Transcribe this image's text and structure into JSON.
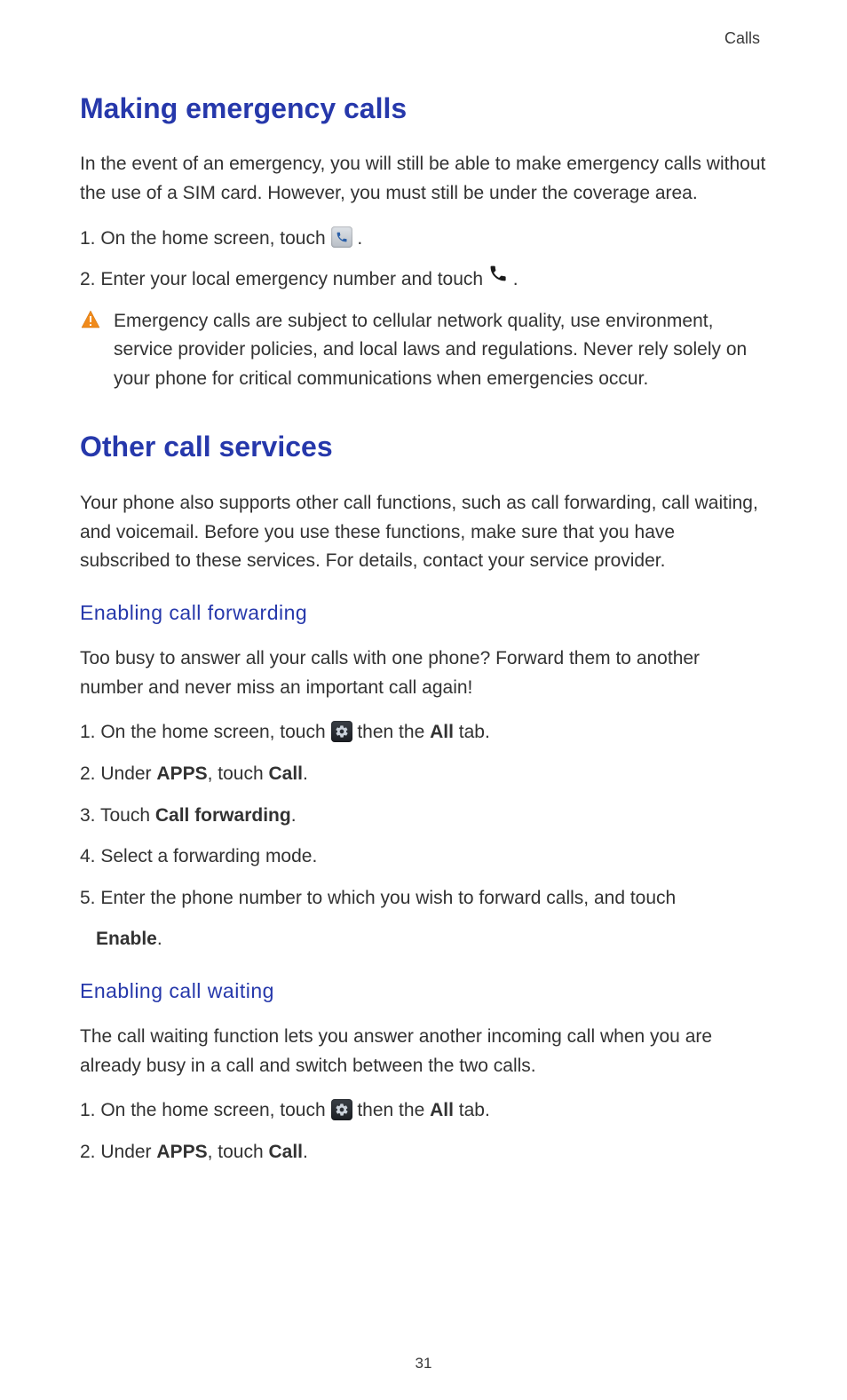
{
  "header": {
    "section_label": "Calls"
  },
  "emergency": {
    "heading": "Making emergency calls",
    "intro": "In the event of an emergency, you will still be able to make emergency calls without the use of a SIM card. However, you must still be under the coverage area.",
    "step1_pre": "1. On the home screen, touch ",
    "step1_post": " .",
    "step2_pre": "2. Enter your local emergency number and touch ",
    "step2_post": " .",
    "warning_text": "Emergency calls are subject to cellular network quality, use environment, service provider policies, and local laws and regulations. Never rely solely on your phone for critical communications when emergencies occur."
  },
  "other": {
    "heading": "Other call services",
    "intro": "Your phone also supports other call functions, such as call forwarding, call waiting, and voicemail. Before you use these functions, make sure that you have subscribed to these services. For details, contact your service provider."
  },
  "forwarding": {
    "subheading": "Enabling call forwarding",
    "intro": "Too busy to answer all your calls with one phone? Forward them to another number and never miss an important call again!",
    "s1_pre": "1. On the home screen, touch ",
    "s1_mid": " then the ",
    "s1_bold": "All",
    "s1_post": " tab.",
    "s2_pre": "2. Under ",
    "s2_b1": "APPS",
    "s2_mid": ", touch ",
    "s2_b2": "Call",
    "s2_post": ".",
    "s3_pre": "3. Touch ",
    "s3_b": "Call forwarding",
    "s3_post": ".",
    "s4": "4. Select a forwarding mode.",
    "s5_pre": "5. Enter the phone number to which you wish to forward calls, and touch ",
    "s5_b": "Enable",
    "s5_post": "."
  },
  "waiting": {
    "subheading": "Enabling call waiting",
    "intro": "The call waiting function lets you answer another incoming call when you are already busy in a call and switch between the two calls.",
    "s1_pre": "1. On the home screen, touch ",
    "s1_mid": " then the ",
    "s1_bold": "All",
    "s1_post": " tab.",
    "s2_pre": "2. Under ",
    "s2_b1": "APPS",
    "s2_mid": ", touch ",
    "s2_b2": "Call",
    "s2_post": "."
  },
  "page_number": "31"
}
